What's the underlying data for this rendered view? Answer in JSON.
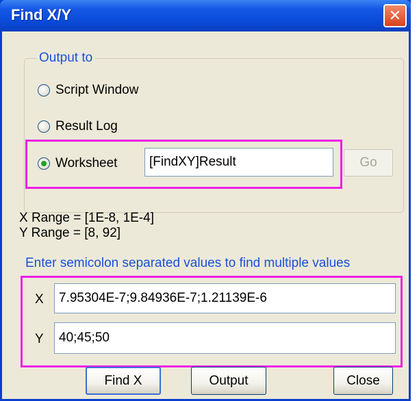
{
  "window": {
    "title": "Find X/Y",
    "close_glyph": "✕"
  },
  "output_group": {
    "legend": "Output to",
    "options": [
      {
        "label": "Script Window",
        "checked": false
      },
      {
        "label": "Result Log",
        "checked": false
      },
      {
        "label": "Worksheet",
        "checked": true
      }
    ],
    "worksheet_value": "[FindXY]Result",
    "go_label": "Go"
  },
  "ranges": {
    "x_range": "X Range = [1E-8, 1E-4]",
    "y_range": "Y Range = [8, 92]"
  },
  "hint": "Enter semicolon separated values to find multiple values",
  "fields": {
    "x_label": "X",
    "x_value": "7.95304E-7;9.84936E-7;1.21139E-6",
    "y_label": "Y",
    "y_value": "40;45;50"
  },
  "buttons": {
    "find_x": "Find X",
    "output": "Output",
    "close": "Close"
  },
  "colors": {
    "highlight": "#ee1ee6",
    "accent_text": "#1d4fd8",
    "titlebar": "#0a4ad8"
  }
}
